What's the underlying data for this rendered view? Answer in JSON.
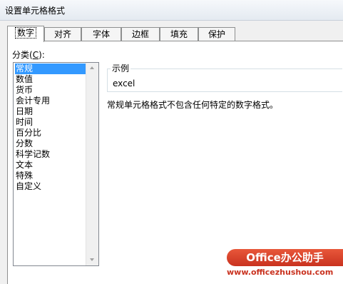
{
  "window": {
    "title": "设置单元格格式"
  },
  "tabs": [
    {
      "label": "数字",
      "active": true
    },
    {
      "label": "对齐"
    },
    {
      "label": "字体"
    },
    {
      "label": "边框"
    },
    {
      "label": "填充"
    },
    {
      "label": "保护"
    }
  ],
  "category": {
    "label_prefix": "分类(",
    "label_hotkey": "C",
    "label_suffix": "):",
    "items": [
      "常规",
      "数值",
      "货币",
      "会计专用",
      "日期",
      "时间",
      "百分比",
      "分数",
      "科学记数",
      "文本",
      "特殊",
      "自定义"
    ],
    "selected": "常规"
  },
  "sample": {
    "legend": "示例",
    "value": "excel"
  },
  "description": "常规单元格格式不包含任何特定的数字格式。",
  "watermark": {
    "badge": "Office办公助手",
    "url": "www.officezhushou.com"
  }
}
